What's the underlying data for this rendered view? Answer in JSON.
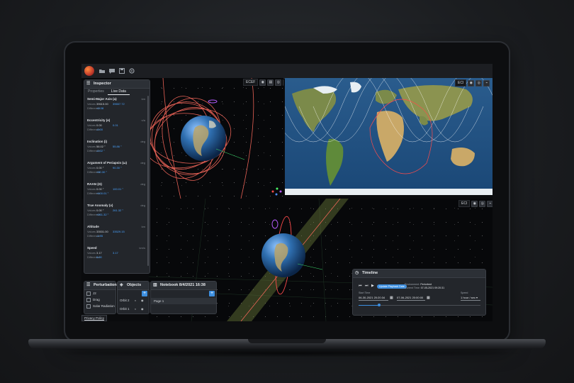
{
  "toolbar": {
    "icons": [
      "folder-icon",
      "chat-icon",
      "save-icon",
      "settings-icon"
    ]
  },
  "viewports": {
    "top_left": {
      "frame_label": "ECEF"
    },
    "top_right": {
      "frame_label": "ECI"
    },
    "bottom": {
      "frame_label": "ECI"
    }
  },
  "inspector": {
    "title": "Inspector",
    "tabs": [
      "Properties",
      "Live Data"
    ],
    "active_tab": "Live Data",
    "value_label": "Values",
    "diff_label": "Difference",
    "properties": [
      {
        "name": "Semi-Major Axis (a)",
        "unit": "km",
        "value": "39615.00",
        "target": "39657.72",
        "diff": "+2.08"
      },
      {
        "name": "Eccentricity (e)",
        "unit": "n/a",
        "value": "0.00",
        "target": "0.01",
        "diff": "-0.00"
      },
      {
        "name": "Inclination (i)",
        "unit": "deg",
        "value": "56.02 °",
        "target": "55.86 °",
        "diff": "-0.02 °"
      },
      {
        "name": "Argument of Periapsis (ω)",
        "unit": "deg",
        "value": "0.00 °",
        "target": "90.30 °",
        "diff": "+90.30 °"
      },
      {
        "name": "RAAN (Ω)",
        "unit": "deg",
        "value": "0.00 °",
        "target": "100.01 °",
        "diff": "+100.01 °"
      },
      {
        "name": "True Anomaly (ν)",
        "unit": "deg",
        "value": "0.00 °",
        "target": "261.32 °",
        "diff": "+261.32 °"
      },
      {
        "name": "Altitude",
        "unit": "km",
        "value": "33531.00",
        "target": "33529.15",
        "diff": "-1.95"
      },
      {
        "name": "Speed",
        "unit": "km/s",
        "value": "3.17",
        "target": "3.17",
        "diff": "0.00"
      }
    ]
  },
  "perturbations": {
    "title": "Perturbations",
    "items": [
      {
        "label": "J2",
        "checked": false
      },
      {
        "label": "Drag",
        "checked": false
      },
      {
        "label": "Solar Radiation",
        "checked": false
      }
    ]
  },
  "objects": {
    "title": "Objects",
    "items": [
      "Orbit 2",
      "Orbit 1"
    ]
  },
  "notebook": {
    "title": "Notebook 8/4/2021 16:38",
    "pages": [
      "Page 1"
    ]
  },
  "timeline": {
    "title": "Timeline",
    "pill": "Update Playback Date",
    "env_label": "Environment:",
    "env_value": "Perturbed",
    "current_label": "Current Time:",
    "current_value": "07-05-2021 09:20:31",
    "start_label": "Start Time",
    "start_value": "06-30-2021 20:20:34",
    "end_value": "07-06-2021 20:00:00",
    "speed_label": "Speed",
    "speed_value": "1 hour / sec"
  },
  "privacy": "Privacy Policy",
  "colors": {
    "accent": "#3d8fe0",
    "orbit": "#ff6b5e",
    "panel": "#23262b"
  }
}
